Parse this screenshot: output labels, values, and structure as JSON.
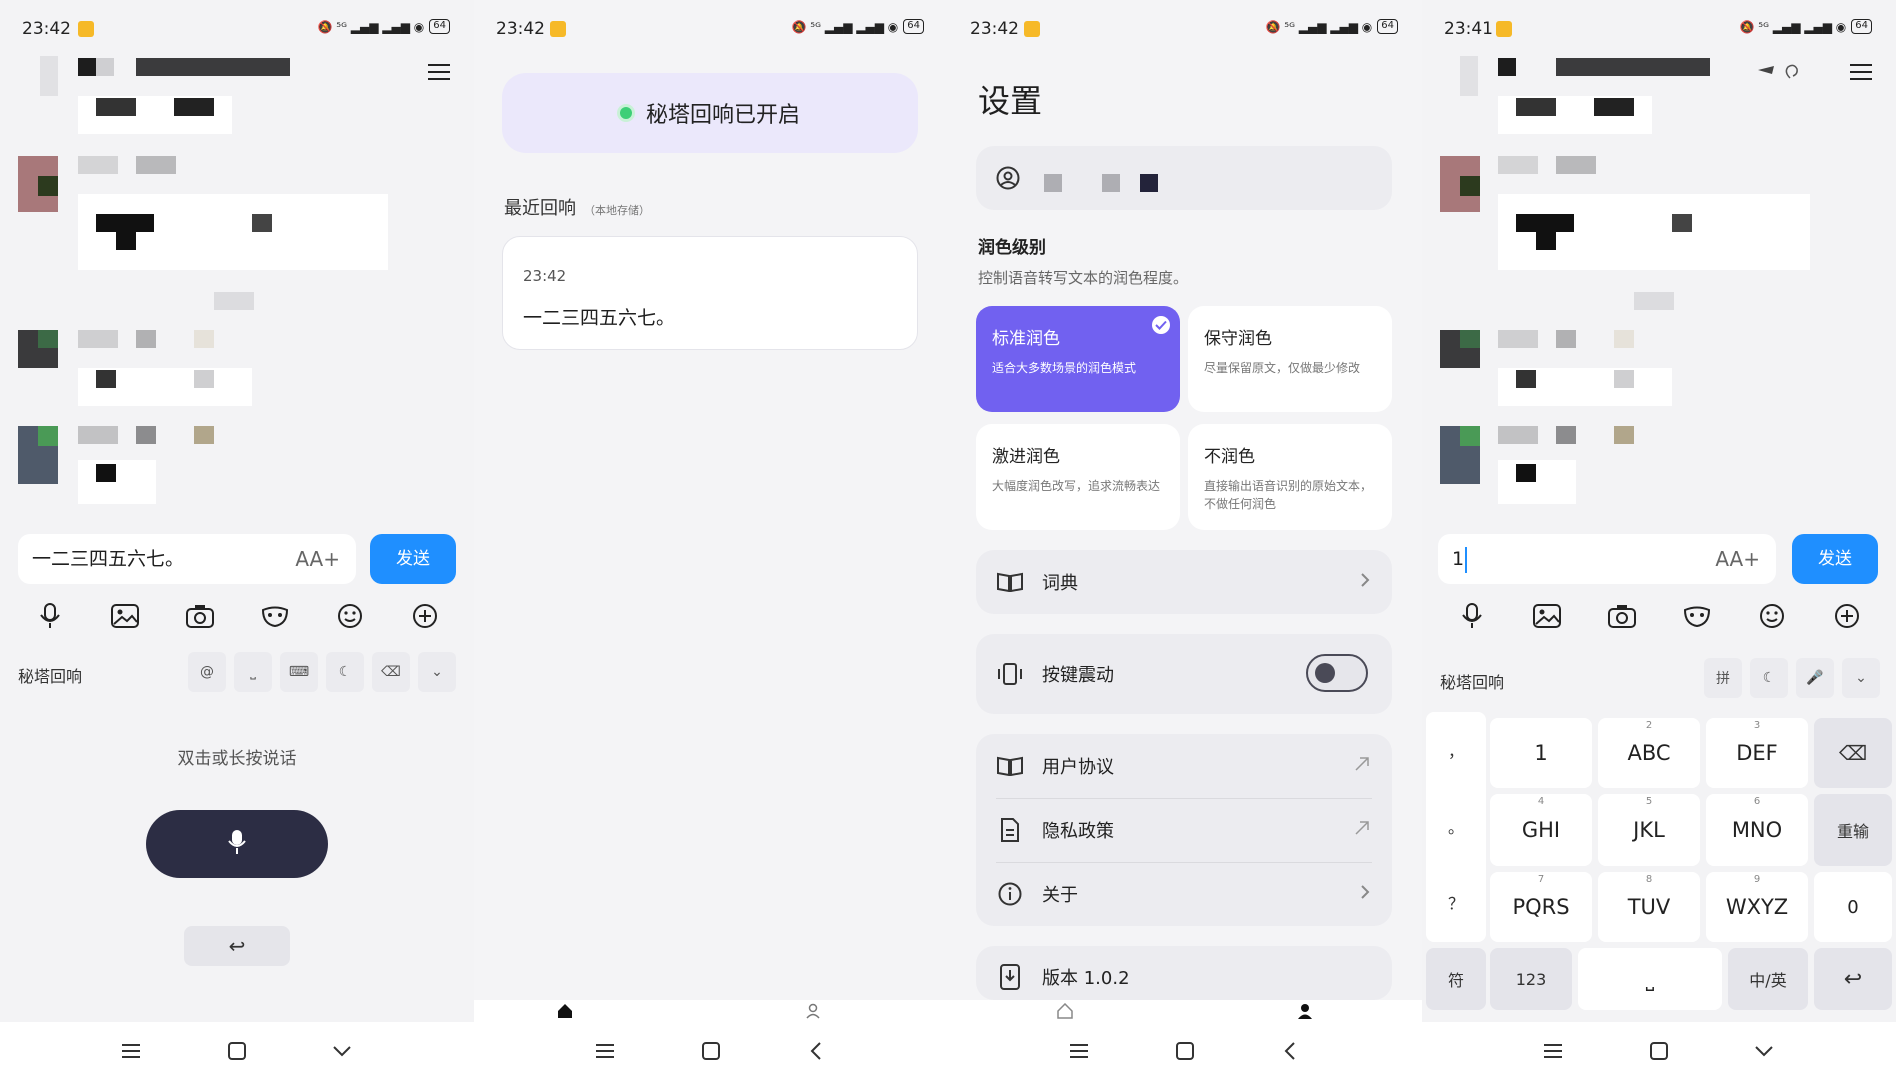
{
  "chat": {
    "left": {
      "time": "23:42",
      "input_value": "一二三四五六七。",
      "send_label": "发送",
      "aa_icon": "AA+",
      "brand": "秘塔回响",
      "toolbar_keys": [
        "@",
        "⎵",
        "⌨",
        "☾",
        "⌫",
        "⌄"
      ],
      "hint": "双击或长按说话",
      "enter_glyph": "↩"
    },
    "right": {
      "time": "23:41",
      "input_value": "1",
      "send_label": "发送",
      "aa_icon": "AA+",
      "brand": "秘塔回响",
      "toolbar_keys": [
        "拼",
        "☾",
        "🎤",
        "⌄"
      ]
    }
  },
  "home": {
    "time": "23:42",
    "banner": "秘塔回响已开启",
    "recent_title": "最近回响",
    "recent_note": "（本地存储）",
    "card_time": "23:42",
    "card_text": "一二三四五六七。"
  },
  "settings": {
    "time": "23:42",
    "title": "设置",
    "polish_label": "润色级别",
    "polish_desc": "控制语音转写文本的润色程度。",
    "options": [
      {
        "title": "标准润色",
        "desc": "适合大多数场景的润色模式",
        "selected": true
      },
      {
        "title": "保守润色",
        "desc": "尽量保留原文，仅做最少修改",
        "selected": false
      },
      {
        "title": "激进润色",
        "desc": "大幅度润色改写，追求流畅表达",
        "selected": false
      },
      {
        "title": "不润色",
        "desc": "直接输出语音识别的原始文本，不做任何润色",
        "selected": false
      }
    ],
    "dictionary": "词典",
    "vibration": "按键震动",
    "vibration_on": false,
    "agreement": "用户协议",
    "privacy": "隐私政策",
    "about": "关于",
    "version": "版本 1.0.2"
  },
  "keyboard": {
    "side": [
      "，",
      "。",
      "？"
    ],
    "keys": [
      {
        "main": "1",
        "sup": ""
      },
      {
        "main": "ABC",
        "sup": "2"
      },
      {
        "main": "DEF",
        "sup": "3"
      },
      {
        "main": "GHI",
        "sup": "4"
      },
      {
        "main": "JKL",
        "sup": "5"
      },
      {
        "main": "MNO",
        "sup": "6"
      },
      {
        "main": "PQRS",
        "sup": "7"
      },
      {
        "main": "TUV",
        "sup": "8"
      },
      {
        "main": "WXYZ",
        "sup": "9"
      }
    ],
    "right_col": [
      "⌫",
      "重输",
      "0"
    ],
    "bottom": {
      "sym": "符",
      "num": "123",
      "space": "⎵",
      "lang": "中/英",
      "enter": "↩"
    }
  },
  "status": {
    "icons": "🔕 ⁵ᴳ ▂▄▆ ▂▄▆ ◉",
    "battery": "64"
  },
  "colors": {
    "accent": "#1f8fff",
    "purple": "#7161f0",
    "dark_button": "#2c2d44",
    "online_dot": "#3ecf77"
  }
}
